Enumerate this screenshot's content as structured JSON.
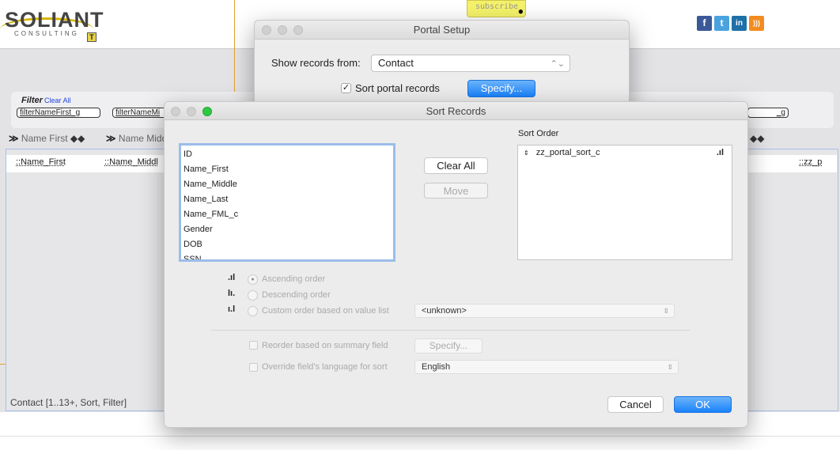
{
  "header": {
    "logo_text": "SOLIANT",
    "logo_sub": "CONSULTING",
    "logo_badge": "T",
    "subscribe_label": "subscribe",
    "social": [
      {
        "name": "facebook",
        "glyph": "f",
        "color": "#3b5998"
      },
      {
        "name": "twitter",
        "glyph": "t",
        "color": "#4aa3df"
      },
      {
        "name": "linkedin",
        "glyph": "in",
        "color": "#1f6fa8"
      },
      {
        "name": "rss",
        "glyph": "rss",
        "color": "#f28b20"
      }
    ]
  },
  "filter": {
    "label": "Filter",
    "clear_all": "Clear All",
    "fields": [
      "filterNameFirst_g",
      "filterNameMi",
      "_g"
    ]
  },
  "columns": {
    "headers": [
      "Name First",
      "Name Midd"
    ],
    "cells": [
      "::Name_First",
      "::Name_Middl",
      "::zz_p"
    ]
  },
  "status": "Contact [1..13+, Sort, Filter]",
  "portal_setup": {
    "title": "Portal Setup",
    "show_records_label": "Show records from:",
    "show_records_value": "Contact",
    "sort_checkbox_label": "Sort portal records",
    "sort_checked": true,
    "specify_label": "Specify..."
  },
  "sort_records": {
    "title": "Sort Records",
    "fields": [
      "ID",
      "Name_First",
      "Name_Middle",
      "Name_Last",
      "Name_FML_c",
      "Gender",
      "DOB",
      "SSN"
    ],
    "clear_all_label": "Clear All",
    "move_label": "Move",
    "sort_order_label": "Sort Order",
    "sort_order_items": [
      "zz_portal_sort_c"
    ],
    "ascending_label": "Ascending order",
    "descending_label": "Descending order",
    "custom_label": "Custom order based on value list",
    "selected_order": "ascending",
    "value_list_value": "<unknown>",
    "reorder_label": "Reorder based on summary field",
    "reorder_specify_label": "Specify...",
    "override_label": "Override field's language for sort",
    "language_value": "English",
    "cancel_label": "Cancel",
    "ok_label": "OK",
    "accent_color": "#1a82fb"
  }
}
